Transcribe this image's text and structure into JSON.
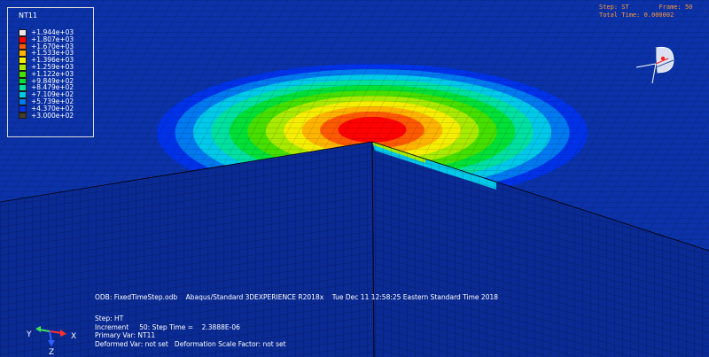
{
  "legend": {
    "title": "NT11",
    "levels": [
      {
        "value": "+1.944e+03",
        "color": "#e8e8e8"
      },
      {
        "value": "+1.807e+03",
        "color": "#ff0000"
      },
      {
        "value": "+1.670e+03",
        "color": "#ff5a00"
      },
      {
        "value": "+1.533e+03",
        "color": "#ffb400"
      },
      {
        "value": "+1.396e+03",
        "color": "#f5ee00"
      },
      {
        "value": "+1.259e+03",
        "color": "#a8ea00"
      },
      {
        "value": "+1.122e+03",
        "color": "#46e000"
      },
      {
        "value": "+9.849e+02",
        "color": "#00e038"
      },
      {
        "value": "+8.479e+02",
        "color": "#00e0a0"
      },
      {
        "value": "+7.109e+02",
        "color": "#00c8e8"
      },
      {
        "value": "+5.739e+02",
        "color": "#0078f0"
      },
      {
        "value": "+4.370e+02",
        "color": "#0032e8"
      },
      {
        "value": "+3.000e+02",
        "color": "#463c28"
      }
    ]
  },
  "status": {
    "step_label": "Step: ST",
    "frame_label": "Frame: 50",
    "total_time": "Total Time: 0.000002"
  },
  "info": {
    "odb": "ODB: FixedTimeStep.odb",
    "solver": "Abaqus/Standard 3DEXPERIENCE R2018x",
    "date": "Tue Dec 11 12:58:25 Eastern Standard Time 2018",
    "step": "Step: HT",
    "increment": "Increment     50: Step Time =    2.3888E-06",
    "primary_var": "Primary Var: NT11",
    "deformed": "Deformed Var: not set   Deformation Scale Factor: not set"
  },
  "triad": {
    "x": "X",
    "y": "Y",
    "z": "Z"
  },
  "colors": {
    "background": "#0a2d96",
    "mesh_line": "#000000",
    "hot": "#ff0000",
    "cold": "#0032e8",
    "status_text": "#ff9a3a"
  }
}
